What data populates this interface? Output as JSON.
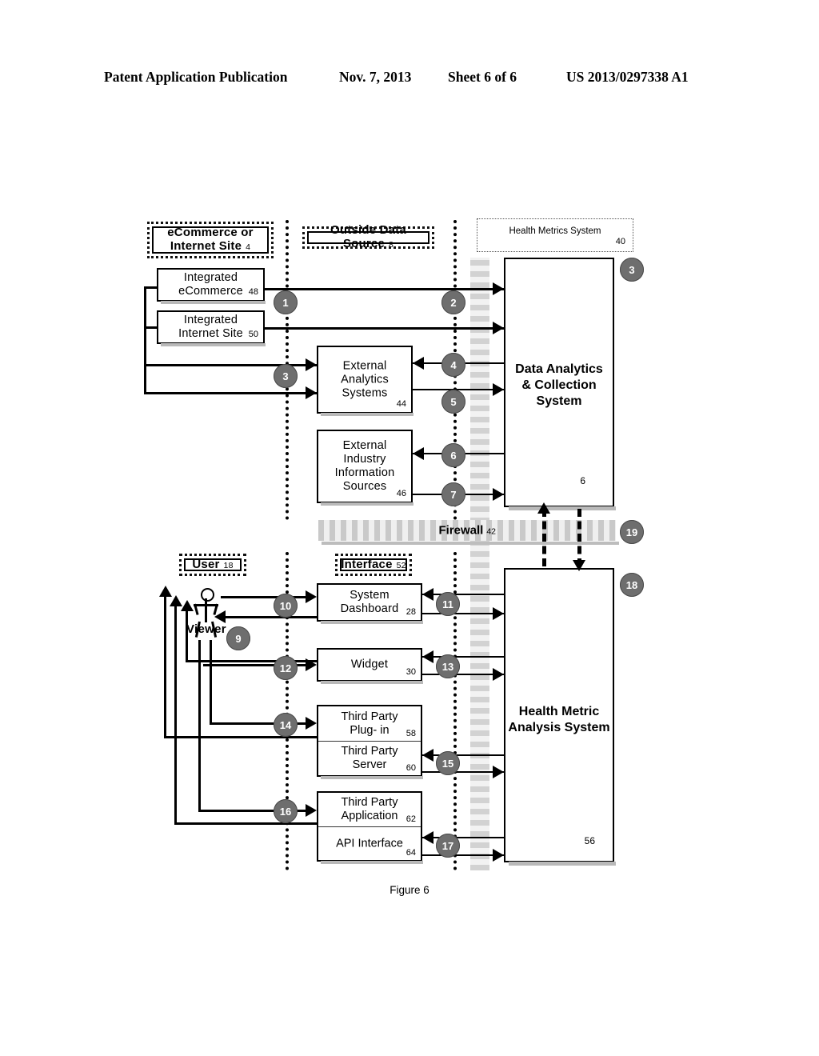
{
  "page_header": {
    "publication": "Patent Application Publication",
    "date": "Nov. 7, 2013",
    "sheet": "Sheet 6 of 6",
    "patent_number": "US 2013/0297338 A1"
  },
  "figure": {
    "caption": "Figure 6",
    "groups": [
      {
        "id": "ecommerce-group",
        "title": "eCommerce or Internet Site",
        "ref": "4"
      },
      {
        "id": "outside-data-source",
        "title": "Outside Data Source",
        "ref": "8"
      },
      {
        "id": "health-metrics-system",
        "title": "Health Metrics System",
        "ref": "40"
      },
      {
        "id": "user-group",
        "title": "User",
        "ref": "18"
      },
      {
        "id": "interface-group",
        "title": "Interface",
        "ref": "52"
      }
    ],
    "nodes": [
      {
        "id": "integrated-ecommerce",
        "label": "Integrated\neCommerce",
        "ref": "48"
      },
      {
        "id": "integrated-internet-site",
        "label": "Integrated\nInternet Site",
        "ref": "50"
      },
      {
        "id": "external-analytics-systems",
        "label": "External\nAnalytics\nSystems",
        "ref": "44"
      },
      {
        "id": "external-industry-information-sources",
        "label": "External\nIndustry\nInformation\nSources",
        "ref": "46"
      },
      {
        "id": "system-dashboard",
        "label": "System\nDashboard",
        "ref": "28"
      },
      {
        "id": "widget",
        "label": "Widget",
        "ref": "30"
      },
      {
        "id": "third-party-plugin",
        "label": "Third Party\nPlug- in",
        "ref": "58"
      },
      {
        "id": "third-party-server",
        "label": "Third Party\nServer",
        "ref": "60"
      },
      {
        "id": "third-party-application",
        "label": "Third Party\nApplication",
        "ref": "62"
      },
      {
        "id": "api-interface",
        "label": "API Interface",
        "ref": "64"
      }
    ],
    "systems": [
      {
        "id": "data-analytics-collection-system",
        "label": "Data Analytics\n& Collection\nSystem",
        "ref": "6"
      },
      {
        "id": "health-metric-analysis-system",
        "label": "Health Metric\nAnalysis System",
        "ref": "56"
      }
    ],
    "firewall": {
      "label": "Firewall",
      "ref": "42"
    },
    "viewer": {
      "label": "Viewer"
    },
    "markers": [
      {
        "n": "1"
      },
      {
        "n": "2"
      },
      {
        "n": "3"
      },
      {
        "n": "3b"
      },
      {
        "n": "4"
      },
      {
        "n": "5"
      },
      {
        "n": "6"
      },
      {
        "n": "7"
      },
      {
        "n": "9"
      },
      {
        "n": "10"
      },
      {
        "n": "11"
      },
      {
        "n": "12"
      },
      {
        "n": "13"
      },
      {
        "n": "14"
      },
      {
        "n": "15"
      },
      {
        "n": "16"
      },
      {
        "n": "17"
      },
      {
        "n": "18"
      },
      {
        "n": "19"
      }
    ]
  }
}
